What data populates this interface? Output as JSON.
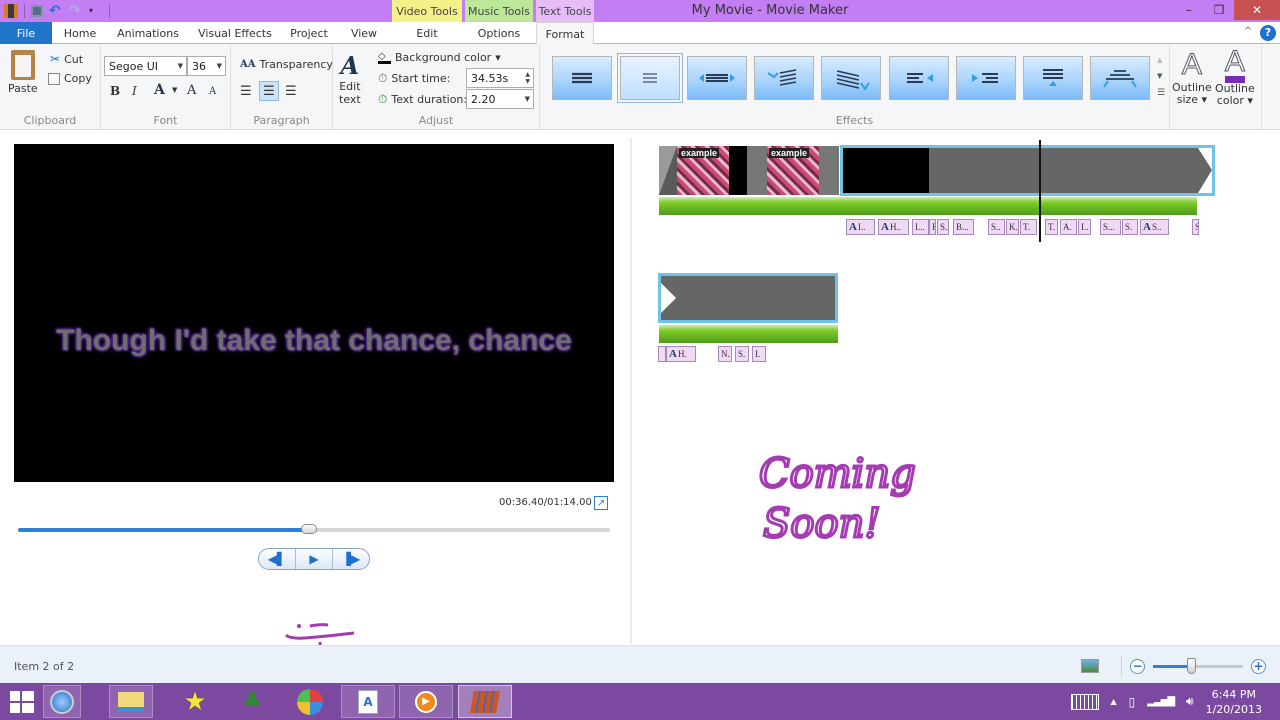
{
  "window": {
    "title": "My Movie - Movie Maker",
    "controls": {
      "minimize": "–",
      "restore": "❐",
      "close": "✕"
    },
    "quick_access": [
      "app-icon",
      "save-icon",
      "undo-icon",
      "redo-icon",
      "customize-icon"
    ]
  },
  "context_tabs": [
    {
      "label": "Video Tools",
      "color": "#f4f08a"
    },
    {
      "label": "Music Tools",
      "color": "#bde89a"
    },
    {
      "label": "Text Tools",
      "color": "#e6bdf7"
    }
  ],
  "tabs": [
    {
      "label": "File"
    },
    {
      "label": "Home"
    },
    {
      "label": "Animations"
    },
    {
      "label": "Visual Effects"
    },
    {
      "label": "Project"
    },
    {
      "label": "View"
    },
    {
      "label": "Edit"
    },
    {
      "label": "Options"
    },
    {
      "label": "Format",
      "active": true
    }
  ],
  "ribbon": {
    "clipboard": {
      "label": "Clipboard",
      "paste": "Paste",
      "cut": "Cut",
      "copy": "Copy"
    },
    "font": {
      "label": "Font",
      "family": "Segoe UI",
      "size": "36",
      "bold": "B",
      "italic": "I",
      "color": "A",
      "grow": "A",
      "shrink": "A"
    },
    "paragraph": {
      "label": "Paragraph",
      "transparency": "Transparency",
      "align": [
        "left",
        "center",
        "right"
      ],
      "selected_align": "center"
    },
    "adjust": {
      "label": "Adjust",
      "edit_text": "Edit text",
      "edit_text_line1": "Edit",
      "edit_text_line2": "text",
      "background_color": "Background color",
      "start_time_label": "Start time:",
      "start_time_value": "34.53s",
      "duration_label": "Text duration:",
      "duration_value": "2.20"
    },
    "effects": {
      "label": "Effects",
      "items": [
        "center",
        "fade-center",
        "stretch",
        "fly-in-left",
        "slide-diagonal",
        "fly-in-right-arrow",
        "fly-in-left-arrow",
        "scroll-up",
        "cinematic"
      ],
      "selected_index": 1
    },
    "outline_size": {
      "line1": "Outline",
      "line2": "size ▾"
    },
    "outline_color": {
      "line1": "Outline",
      "line2": "color ▾",
      "color": "#7a2ab5"
    }
  },
  "preview": {
    "caption": "Though I'd take that chance, chance",
    "timecode": "00:36.40/01:14.00",
    "progress_fraction": 0.492,
    "transport": {
      "prev": "◀▌",
      "play": "▶",
      "next": "▐▶"
    }
  },
  "storyboard": {
    "row1": {
      "thumb_label": "example",
      "captions": [
        {
          "icon": "A",
          "text": "I.."
        },
        {
          "icon": "A",
          "text": "H.."
        },
        {
          "icon": "",
          "text": "I..."
        },
        {
          "icon": "",
          "text": "B"
        },
        {
          "icon": "",
          "text": "S.."
        },
        {
          "icon": "",
          "text": "B..."
        },
        {
          "icon": "",
          "text": "S.."
        },
        {
          "icon": "",
          "text": "K.."
        },
        {
          "icon": "",
          "text": "T."
        },
        {
          "icon": "",
          "text": "T."
        },
        {
          "icon": "",
          "text": "A."
        },
        {
          "icon": "",
          "text": "I.."
        },
        {
          "icon": "",
          "text": "S..."
        },
        {
          "icon": "",
          "text": "S."
        },
        {
          "icon": "A",
          "text": "S.."
        },
        {
          "icon": "",
          "text": "S"
        }
      ]
    },
    "row2": {
      "captions": [
        {
          "icon": "",
          "text": ""
        },
        {
          "icon": "A",
          "text": "H."
        },
        {
          "icon": "",
          "text": "N."
        },
        {
          "icon": "",
          "text": "S."
        },
        {
          "icon": "",
          "text": "I."
        }
      ]
    },
    "annotation": {
      "line1": "Coming",
      "line2": "Soon!",
      "color": "#a53bb3"
    }
  },
  "status": {
    "text": "Item 2 of 2",
    "zoom_fraction": 0.42,
    "zoom_out": "−",
    "zoom_in": "+"
  },
  "taskbar": {
    "apps": [
      "start",
      "safari",
      "file-explorer",
      "star-app",
      "terraria",
      "sims",
      "wordpad",
      "media-player",
      "movie-maker"
    ],
    "clock_time": "6:44 PM",
    "clock_date": "1/20/2013"
  }
}
